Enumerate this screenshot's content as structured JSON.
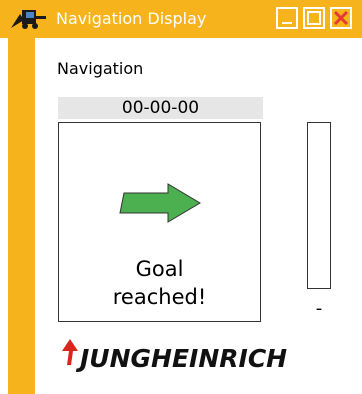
{
  "window": {
    "title": "Navigation Display",
    "app_icon": "forklift-icon",
    "controls": [
      "minimize-icon",
      "maximize-icon",
      "close-icon"
    ]
  },
  "panel": {
    "label": "Navigation",
    "date": "00-00-00",
    "direction_icon": "arrow-right-icon",
    "status_line1": "Goal",
    "status_line2": "reached!",
    "side_value": "-"
  },
  "logo": {
    "text": "JUNGHEINRICH"
  },
  "colors": {
    "accent": "#f7b31b",
    "arrow": "#4caf50",
    "logo_red": "#d9261c"
  }
}
